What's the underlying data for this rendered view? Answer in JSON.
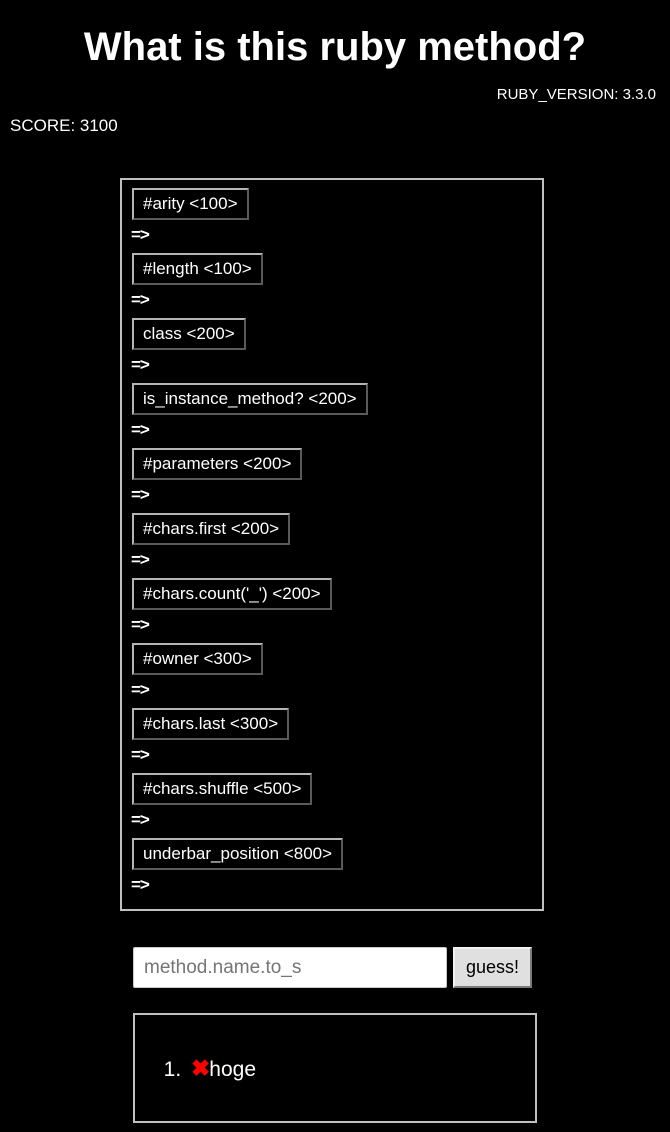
{
  "header": {
    "title": "What is this ruby method?",
    "ruby_version_label": "RUBY_VERSION: 3.3.0",
    "score_label": "SCORE: 3100"
  },
  "hints": {
    "arrow": "=>",
    "items": [
      {
        "label": "#arity <100>",
        "cost": 100,
        "result": ""
      },
      {
        "label": "#length <100>",
        "cost": 100,
        "result": ""
      },
      {
        "label": "class <200>",
        "cost": 200,
        "result": ""
      },
      {
        "label": "is_instance_method? <200>",
        "cost": 200,
        "result": ""
      },
      {
        "label": "#parameters <200>",
        "cost": 200,
        "result": ""
      },
      {
        "label": "#chars.first <200>",
        "cost": 200,
        "result": ""
      },
      {
        "label": "#chars.count('_') <200>",
        "cost": 200,
        "result": ""
      },
      {
        "label": "#owner <300>",
        "cost": 300,
        "result": ""
      },
      {
        "label": "#chars.last <300>",
        "cost": 300,
        "result": ""
      },
      {
        "label": "#chars.shuffle <500>",
        "cost": 500,
        "result": ""
      },
      {
        "label": "underbar_position <800>",
        "cost": 800,
        "result": ""
      }
    ]
  },
  "guess": {
    "input_value": "",
    "placeholder": "method.name.to_s",
    "button_label": "guess!"
  },
  "answers": {
    "items": [
      {
        "mark": "✖",
        "text": "hoge",
        "correct": false
      }
    ]
  },
  "colors": {
    "background": "#000000",
    "foreground": "#ffffff",
    "border": "#c0c0c0",
    "wrong_mark": "#ff0000"
  }
}
